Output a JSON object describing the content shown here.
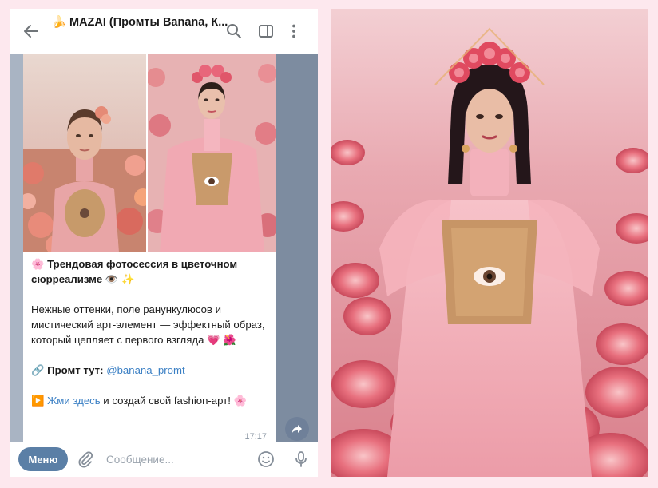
{
  "header": {
    "back_icon": "arrow-left-icon",
    "banana_emoji": "🍌",
    "title": "MAZAI (Промты Banana, К...",
    "search_icon": "search-icon",
    "panel_icon": "side-panel-icon",
    "more_icon": "more-vertical-icon"
  },
  "message": {
    "line1_emoji": "🌸",
    "headline": "Трендовая фотосессия в цветочном сюрреализме",
    "headline_emojis": "👁️ ✨",
    "body": "Нежные оттенки, поле ранункулюсов и мистический арт-элемент — эффектный образ, который цепляет с первого взгляда",
    "body_emojis": "💗 🌺",
    "prompt_emoji": "🔗",
    "prompt_label": "Промт тут:",
    "prompt_link": "@banana_promt",
    "cta_emoji": "▶️",
    "cta_link": "Жми здесь",
    "cta_text": "и создай свой fashion-арт!",
    "cta_trailing_emoji": "🌸",
    "time": "17:17"
  },
  "input": {
    "menu_label": "Меню",
    "placeholder": "Сообщение..."
  },
  "colors": {
    "accent": "#5b7fa6",
    "link": "#3a7fc4",
    "chat_bg": "#a9b4c3",
    "page_bg": "#fde8ee"
  }
}
